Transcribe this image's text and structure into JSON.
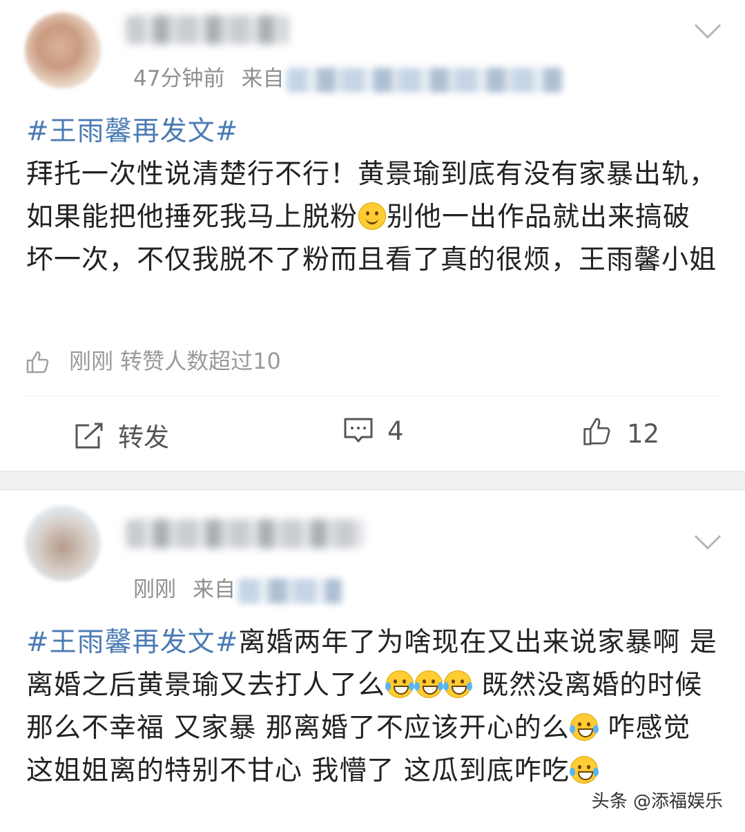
{
  "posts": [
    {
      "time": "47分钟前",
      "source_prefix": "来自",
      "hashtag": "#王雨馨再发文#",
      "text_parts": [
        "拜托一次性说清楚行不行！黄景瑜到底有没有家暴出轨，如果能把他捶死我马上脱粉",
        "别他一出作品就出来搞破坏一次，不仅我脱不了粉而且看了真的很烦，王雨馨小姐"
      ],
      "like_status": "刚刚 转赞人数超过10",
      "actions": {
        "repost_label": "转发",
        "comment_count": "4",
        "like_count": "12"
      },
      "icons": {
        "smile_emoji": "smile-emoji",
        "like": "thumbs-up-icon"
      }
    },
    {
      "time": "刚刚",
      "source_prefix": "来自",
      "hashtag": "#王雨馨再发文#",
      "text_parts": [
        "离婚两年了为啥现在又出来说家暴啊 是离婚之后黄景瑜又去打人了么",
        " 既然没离婚的时候那么不幸福 又家暴 那离婚了不应该开心的么",
        " 咋感觉这姐姐离的特别不甘心 我懵了 这瓜到底咋吃"
      ]
    }
  ],
  "watermark": "头条 @添福娱乐",
  "colors": {
    "hashtag": "#4b7bb4",
    "meta": "#8f8f8f",
    "separator": "#f1f1f1"
  }
}
